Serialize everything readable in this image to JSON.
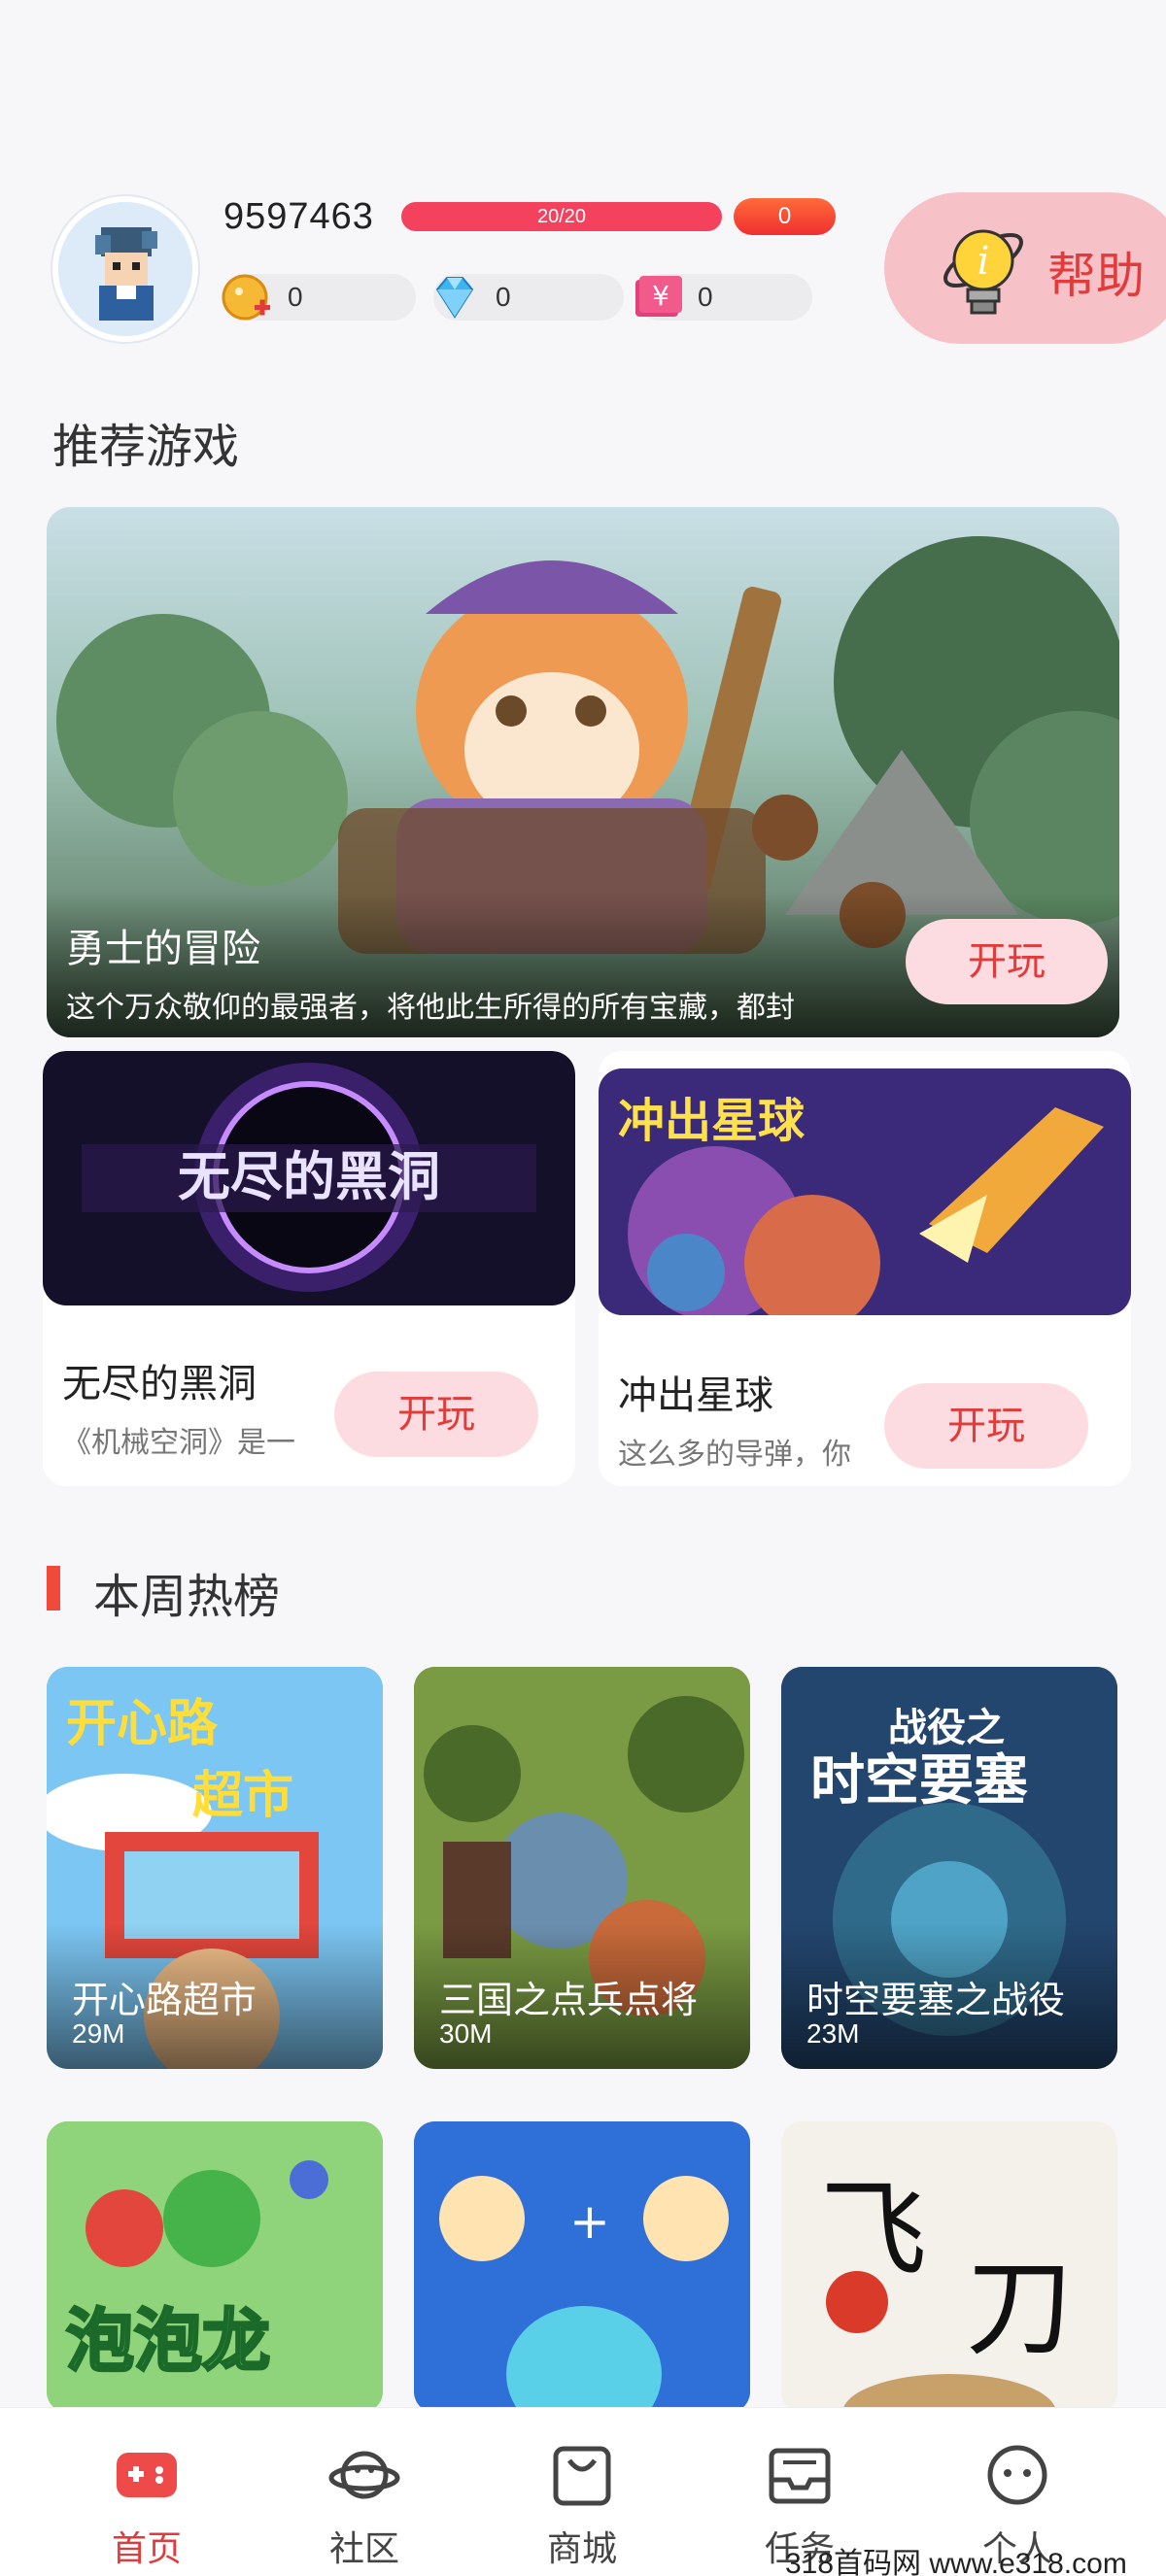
{
  "header": {
    "user_id": "9597463",
    "energy": {
      "text": "20/20",
      "fraction": 1.0,
      "badge": "0"
    },
    "currencies": [
      {
        "icon": "gold-coin-icon",
        "value": "0"
      },
      {
        "icon": "diamond-icon",
        "value": "0"
      },
      {
        "icon": "yuan-cash-icon",
        "value": "0"
      }
    ],
    "help_label": "帮助"
  },
  "recommended": {
    "section_title": "推荐游戏",
    "featured": {
      "title": "勇士的冒险",
      "desc": "这个万众敬仰的最强者，将他此生所得的所有宝藏，都封",
      "play_label": "开玩"
    },
    "cards": [
      {
        "name": "无尽的黑洞",
        "desc": "《机械空洞》是一",
        "play_label": "开玩"
      },
      {
        "name": "冲出星球",
        "desc": "这么多的导弹，你",
        "play_label": "开玩"
      }
    ]
  },
  "weekly": {
    "section_title": "本周热榜",
    "games": [
      {
        "name": "开心路超市",
        "size": "29M"
      },
      {
        "name": "三国之点兵点将",
        "size": "30M"
      },
      {
        "name": "时空要塞之战役",
        "size": "23M"
      },
      {
        "name": "",
        "size": ""
      },
      {
        "name": "",
        "size": ""
      },
      {
        "name": "",
        "size": ""
      }
    ]
  },
  "nav": {
    "items": [
      {
        "label": "首页",
        "icon": "gamepad-icon",
        "active": true
      },
      {
        "label": "社区",
        "icon": "planet-icon",
        "active": false
      },
      {
        "label": "商城",
        "icon": "shopping-bag-icon",
        "active": false
      },
      {
        "label": "任务",
        "icon": "inbox-tray-icon",
        "active": false
      },
      {
        "label": "个人",
        "icon": "smiley-face-icon",
        "active": false
      }
    ]
  },
  "watermark": "318首码网 www.e318.com",
  "colors": {
    "accent": "#e23b3b",
    "play_button_bg": "#fcdce0",
    "energy_bar": "#f3415e"
  }
}
